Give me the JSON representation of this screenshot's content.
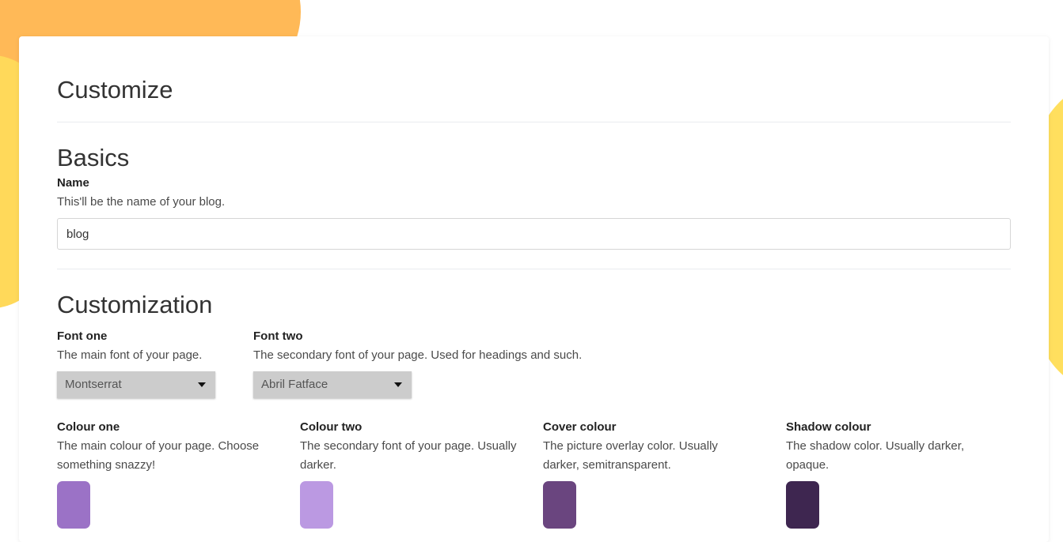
{
  "page": {
    "title": "Customize"
  },
  "basics": {
    "title": "Basics",
    "name": {
      "label": "Name",
      "help": "This'll be the name of your blog.",
      "value": "blog"
    }
  },
  "customization": {
    "title": "Customization",
    "font_one": {
      "label": "Font one",
      "help": "The main font of your page.",
      "selected": "Montserrat"
    },
    "font_two": {
      "label": "Font two",
      "help": "The secondary font of your page. Used for headings and such.",
      "selected": "Abril Fatface"
    },
    "colours": [
      {
        "label": "Colour one",
        "help": "The main colour of your page. Choose something snazzy!",
        "color": "#9b72c6"
      },
      {
        "label": "Colour two",
        "help": "The secondary font of your page. Usually darker.",
        "color": "#bb99e2"
      },
      {
        "label": "Cover colour",
        "help": "The picture overlay color. Usually darker, semitransparent.",
        "color": "#6a457f"
      },
      {
        "label": "Shadow colour",
        "help": "The shadow color. Usually darker, opaque.",
        "color": "#3e2650"
      }
    ]
  },
  "theme": {
    "background_orange": "#ffb957",
    "background_yellow": "#ffd95a"
  }
}
